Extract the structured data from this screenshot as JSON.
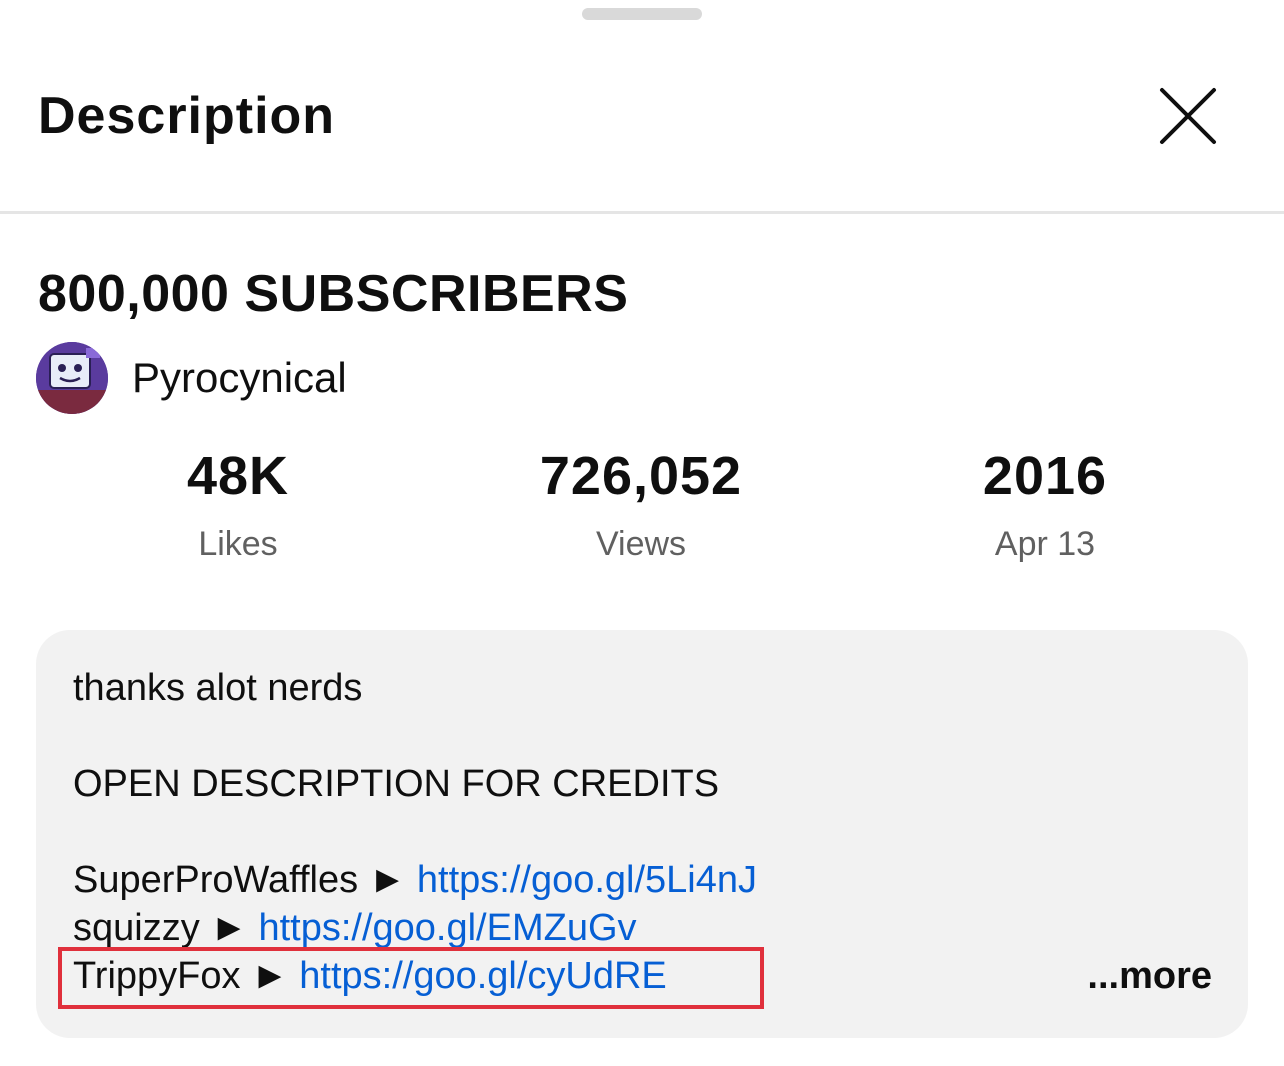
{
  "header": {
    "title": "Description",
    "close_icon": "close-icon"
  },
  "video": {
    "title": "800,000 SUBSCRIBERS",
    "channel_name": "Pyrocynical",
    "avatar_icon": "channel-avatar"
  },
  "stats": [
    {
      "value": "48K",
      "label": "Likes"
    },
    {
      "value": "726,052",
      "label": "Views"
    },
    {
      "value": "2016",
      "label": "Apr 13"
    }
  ],
  "description": {
    "line1": "thanks alot nerds",
    "line2": "OPEN DESCRIPTION FOR CREDITS",
    "credits": [
      {
        "name": "SuperProWaffles",
        "arrow": "►",
        "url": "https://goo.gl/5Li4nJ"
      },
      {
        "name": "squizzy",
        "arrow": "►",
        "url": "https://goo.gl/EMZuGv"
      },
      {
        "name": "TrippyFox",
        "arrow": "►",
        "url": "https://goo.gl/cyUdRE"
      }
    ],
    "more_label": "...more"
  },
  "colors": {
    "link": "#065fd4",
    "card_bg": "#f2f2f2",
    "highlight": "#e0303c",
    "secondary_text": "#606060"
  }
}
